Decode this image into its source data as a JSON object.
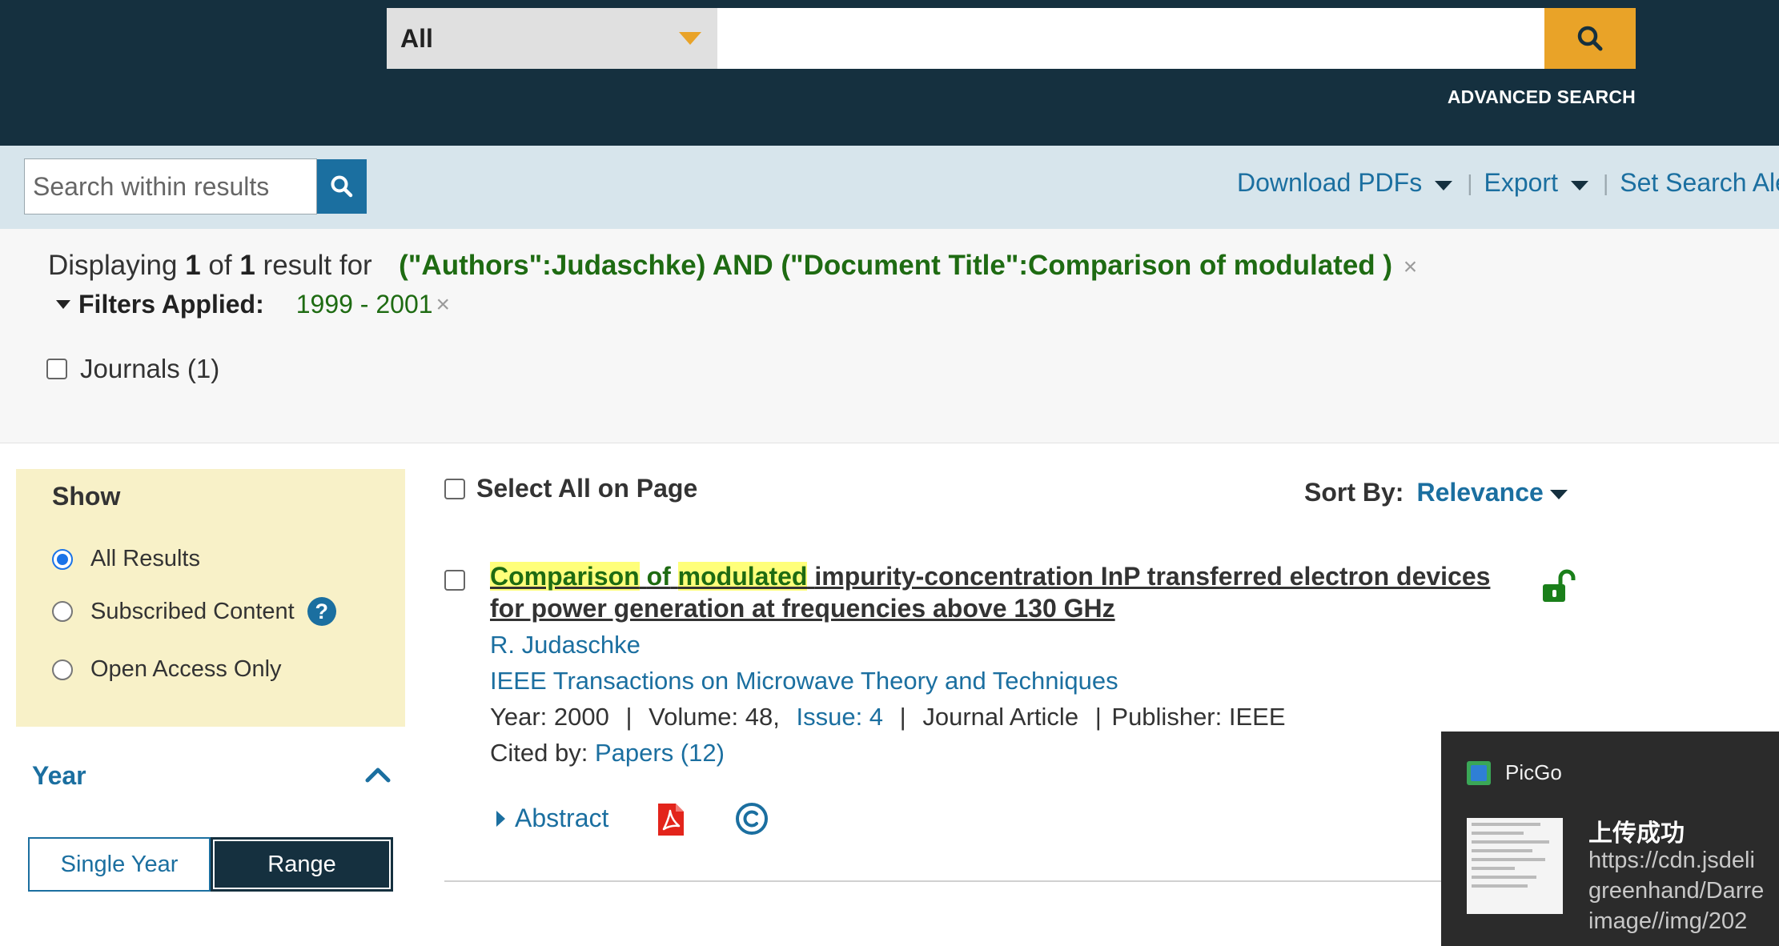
{
  "header": {
    "scope_label": "All",
    "search_value": "",
    "advanced_search_label": "ADVANCED SEARCH"
  },
  "toolbar": {
    "within_placeholder": "Search within results",
    "download_pdfs": "Download PDFs",
    "export": "Export",
    "set_search_alerts": "Set Search Ale",
    "separator": "|"
  },
  "summary": {
    "displaying": "Displaying",
    "count_shown": "1",
    "of": "of",
    "total": "1",
    "result_for": "result  for",
    "query": "(\"Authors\":Judaschke) AND (\"Document Title\":Comparison of modulated )",
    "filters_applied_label": "Filters Applied:",
    "filter_value": "1999 - 2001",
    "remove_mark": "×",
    "journals_label": "Journals (1)"
  },
  "sidebar": {
    "show_title": "Show",
    "options": [
      {
        "label": "All Results",
        "selected": true
      },
      {
        "label": "Subscribed Content",
        "selected": false
      },
      {
        "label": "Open Access Only",
        "selected": false
      }
    ],
    "help_glyph": "?",
    "year_title": "Year",
    "year_toggle": {
      "single": "Single Year",
      "range": "Range",
      "active": "range"
    }
  },
  "results_header": {
    "select_all": "Select All on Page",
    "sort_by_label": "Sort By:",
    "sort_by_value": "Relevance"
  },
  "result": {
    "title_parts": {
      "w1": "Comparison",
      "w2": "of",
      "w3": "modulated",
      "rest": "impurity-concentration InP transferred electron devices for power generation at frequencies above 130 GHz"
    },
    "author": "R. Judaschke",
    "publication": "IEEE Transactions on Microwave Theory and Techniques",
    "year_text": "Year: 2000",
    "volume_text": "Volume: 48,",
    "issue_text": "Issue: 4",
    "type_text": "Journal Article",
    "publisher_text": "Publisher:  IEEE",
    "cited_by_label": "Cited by:",
    "cited_by_link": "Papers (12)",
    "abstract_label": "Abstract",
    "icons": {
      "access": "unlocked-icon",
      "pdf": "pdf-icon",
      "rights": "copyright-icon"
    }
  },
  "toast": {
    "app_name": "PicGo",
    "title": "上传成功",
    "url": "https://cdn.jsdeli\ngreenhand/Darre\nimage//img/202"
  },
  "colors": {
    "header_bg": "#15303f",
    "accent": "#e9a328",
    "link": "#1b6fa0",
    "query_green": "#1e6b12",
    "highlight": "#ffff7a",
    "show_panel": "#f8f1c8"
  }
}
